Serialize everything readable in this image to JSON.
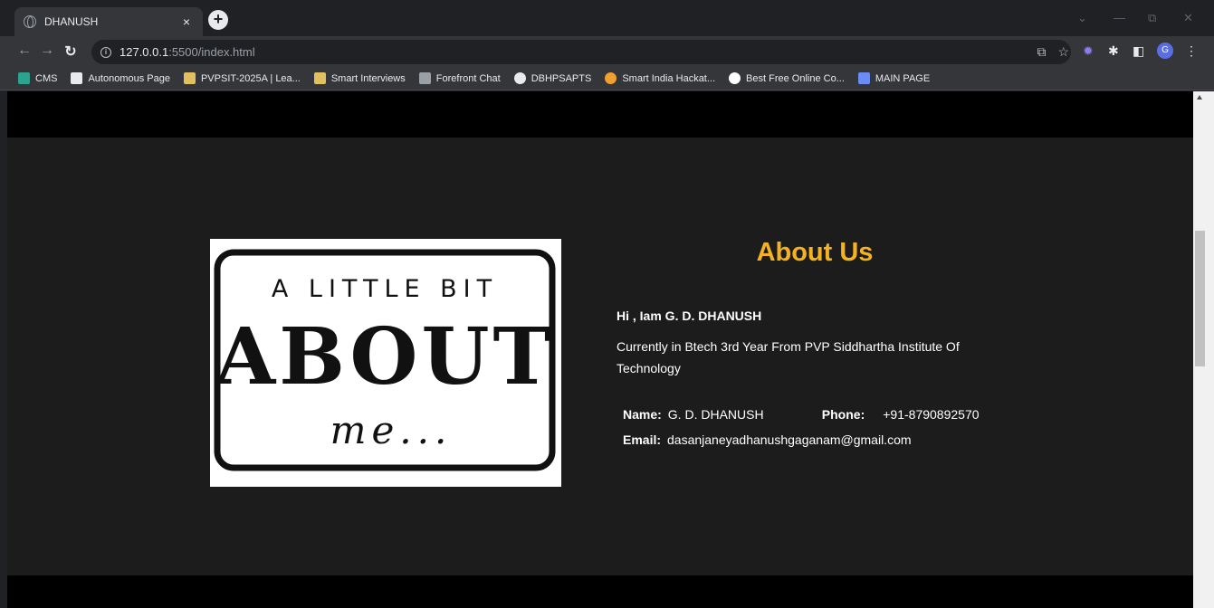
{
  "browser": {
    "tab_title": "DHANUSH",
    "tab_close": "×",
    "new_tab": "+",
    "url_host": "127.0.0.1",
    "url_rest": ":5500/index.html",
    "avatar_letter": "G",
    "bookmarks": [
      {
        "label": "CMS",
        "icon": "cms-icon",
        "color": "#2aa38f"
      },
      {
        "label": "Autonomous Page",
        "icon": "sit-icon",
        "color": "#e8eaed"
      },
      {
        "label": "PVPSIT-2025A | Lea...",
        "icon": "pvpsit-icon",
        "color": "#e0c060"
      },
      {
        "label": "Smart Interviews",
        "icon": "smart-interviews-icon",
        "color": "#e0c060"
      },
      {
        "label": "Forefront Chat",
        "icon": "forefront-icon",
        "color": "#9aa0a6"
      },
      {
        "label": "DBHPSAPTS",
        "icon": "globe-icon",
        "color": "#e8eaed"
      },
      {
        "label": "Smart India Hackat...",
        "icon": "balloon-icon",
        "color": "#f0a030"
      },
      {
        "label": "Best Free Online Co...",
        "icon": "google-icon",
        "color": "#ffffff"
      },
      {
        "label": "MAIN PAGE",
        "icon": "main-page-icon",
        "color": "#6c8cf5"
      }
    ]
  },
  "page": {
    "image_text": {
      "line1": "A LITTLE BIT",
      "line2": "ABOUT",
      "line3": "me..."
    },
    "about_title": "About Us",
    "greeting": "Hi , Iam G. D. DHANUSH",
    "description": "Currently in Btech 3rd Year From PVP Siddhartha Institute Of Technology",
    "name_label": "Name:",
    "name_value": "G. D. DHANUSH",
    "phone_label": "Phone:",
    "phone_value": "+91-8790892570",
    "email_label": "Email:",
    "email_value": "dasanjaneyadhanushgaganam@gmail.com"
  },
  "colors": {
    "accent": "#f4b223",
    "page_bg": "#1c1c1c",
    "band_bg": "#000000"
  }
}
